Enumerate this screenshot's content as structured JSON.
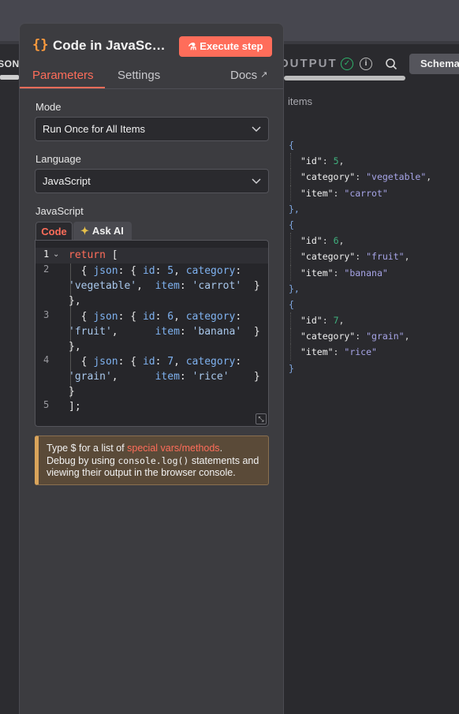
{
  "node": {
    "icon": "code-braces-icon",
    "title": "Code in JavaScri...",
    "execute_label": "Execute step",
    "tabs": {
      "parameters": "Parameters",
      "settings": "Settings",
      "docs": "Docs"
    }
  },
  "params": {
    "mode_label": "Mode",
    "mode_value": "Run Once for All Items",
    "language_label": "Language",
    "language_value": "JavaScript",
    "editor_label": "JavaScript",
    "code_tab": "Code",
    "ask_ai_tab": "Ask AI"
  },
  "code_lines": {
    "n1": "1",
    "n2": "2",
    "n3": "3",
    "n4": "4",
    "n5": "5"
  },
  "notice": {
    "pre": "Type $ for a list of ",
    "link": "special vars/methods",
    "post": ".",
    "line2_pre": "Debug by using ",
    "line2_code": "console.log()",
    "line2_post": " statements and",
    "line3": "viewing their output in the browser console."
  },
  "output": {
    "title": "OUTPUT",
    "schema_tab": "Schema",
    "items_label": "items",
    "left_label": "JSON",
    "records": [
      {
        "id": "5",
        "category": "\"vegetable\"",
        "item": "\"carrot\""
      },
      {
        "id": "6",
        "category": "\"fruit\"",
        "item": "\"banana\""
      },
      {
        "id": "7",
        "category": "\"grain\"",
        "item": "\"rice\""
      }
    ]
  },
  "colors": {
    "accent": "#ff6d5a",
    "success": "#2fb36b",
    "warning_border": "#d9a45b"
  }
}
